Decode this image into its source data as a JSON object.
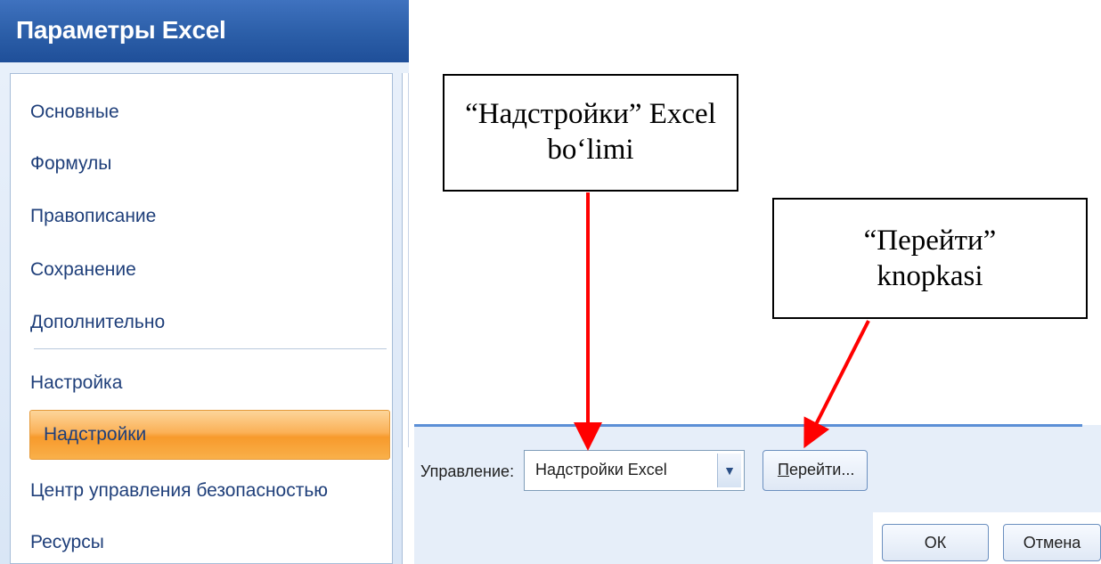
{
  "dialog": {
    "title": "Параметры Excel",
    "nav_items": [
      "Основные",
      "Формулы",
      "Правописание",
      "Сохранение",
      "Дополнительно",
      "Настройка",
      "Надстройки",
      "Центр управления безопасностью",
      "Ресурсы"
    ],
    "selected_index": 6
  },
  "manage": {
    "label": "Управление:",
    "selected": "Надстройки Excel",
    "go_button_underlined": "П",
    "go_button_rest": "ерейти..."
  },
  "footer": {
    "ok": "ОК",
    "cancel": "Отмена"
  },
  "annotations": {
    "callout1_line1": "“Надстройки” Excel",
    "callout1_line2": "bo‘limi",
    "callout2_line1": "“Перейти”",
    "callout2_line2": "knopkasi"
  },
  "colors": {
    "title_bar": "#2b5ea8",
    "selected_item": "#fbb157",
    "arrow": "#ff0000",
    "nav_text": "#1f3f7a"
  }
}
